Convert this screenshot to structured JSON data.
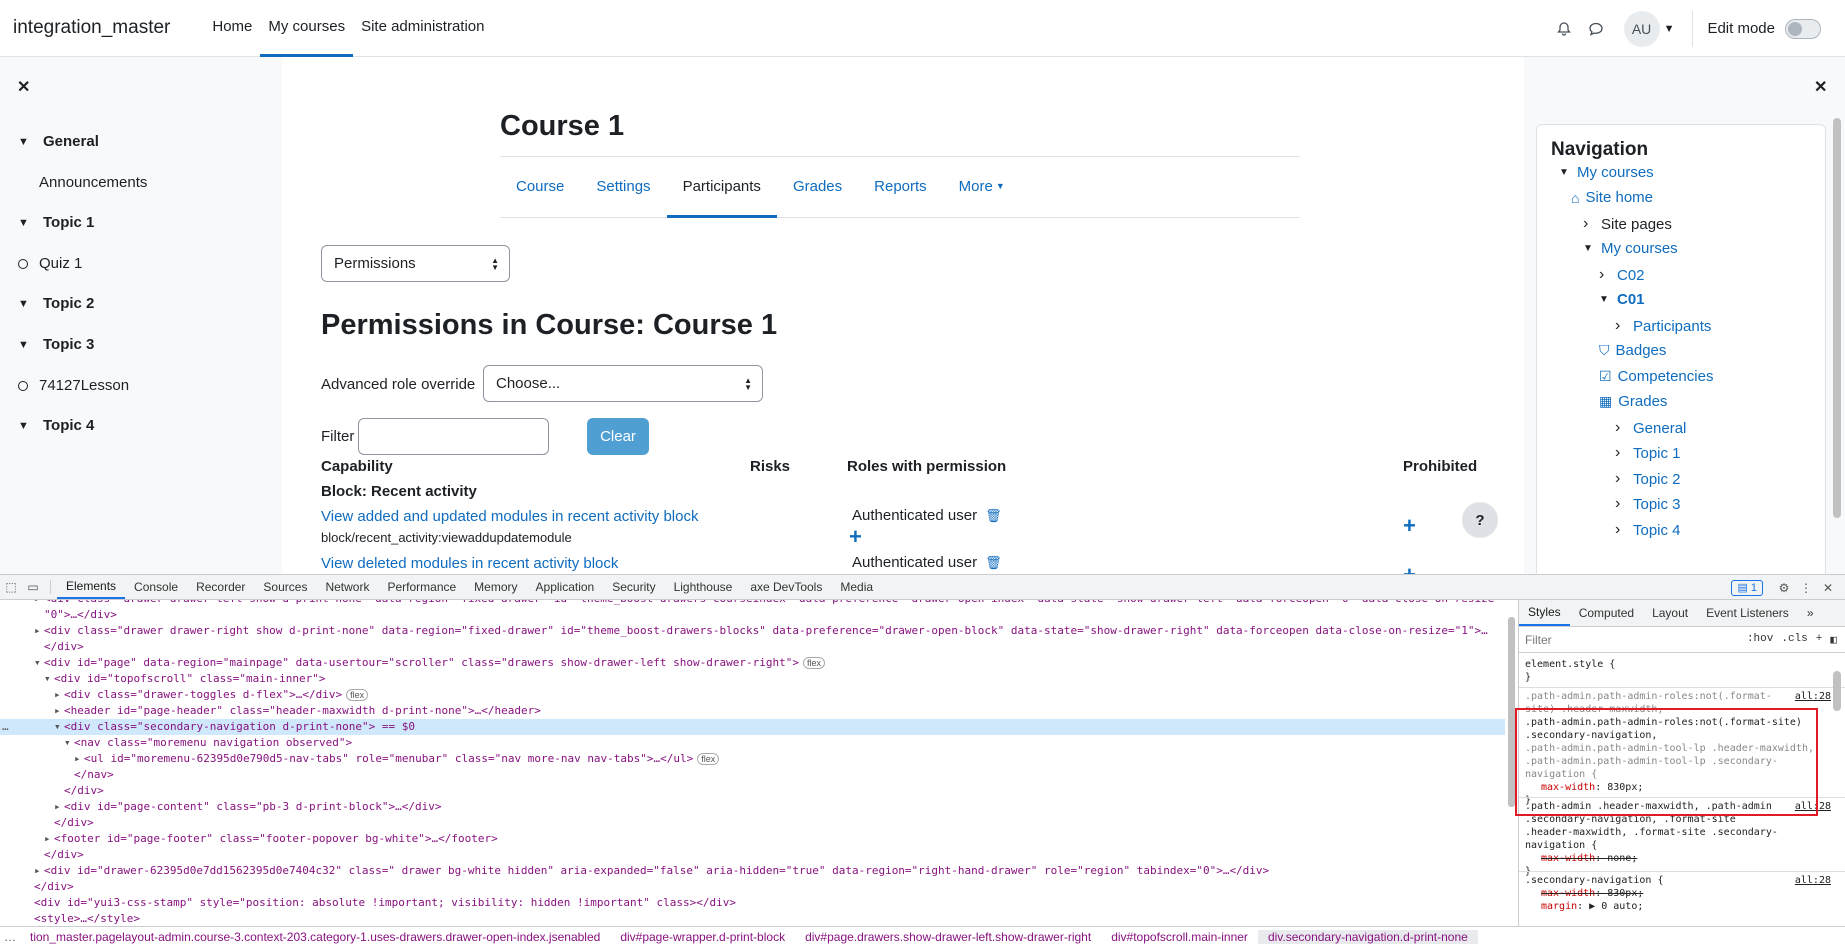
{
  "navbar": {
    "brand": "integration_master",
    "links": [
      "Home",
      "My courses",
      "Site administration"
    ],
    "active": "My courses",
    "avatar_initials": "AU",
    "edit_mode_label": "Edit mode"
  },
  "course_index": {
    "items": [
      {
        "type": "section",
        "label": "General"
      },
      {
        "type": "item",
        "label": "Announcements"
      },
      {
        "type": "section",
        "label": "Topic 1"
      },
      {
        "type": "activity",
        "label": "Quiz 1"
      },
      {
        "type": "section",
        "label": "Topic 2"
      },
      {
        "type": "section",
        "label": "Topic 3"
      },
      {
        "type": "activity",
        "label": "74127Lesson"
      },
      {
        "type": "section",
        "label": "Topic 4"
      }
    ]
  },
  "main": {
    "course_title": "Course 1",
    "tabs": [
      "Course",
      "Settings",
      "Participants",
      "Grades",
      "Reports",
      "More"
    ],
    "active_tab": "Participants",
    "page_select": "Permissions",
    "heading": "Permissions in Course: Course 1",
    "advanced_role_override_label": "Advanced role override",
    "advanced_role_override_value": "Choose...",
    "filter_label": "Filter",
    "filter_value": "",
    "clear_label": "Clear",
    "table": {
      "headers": [
        "Capability",
        "Risks",
        "Roles with permission",
        "Prohibited"
      ],
      "group": "Block: Recent activity",
      "rows": [
        {
          "capability": "View added and updated modules in recent activity block",
          "code": "block/recent_activity:viewaddupdatemodule",
          "role": "Authenticated user"
        },
        {
          "capability": "View deleted modules in recent activity block",
          "code": "",
          "role": "Authenticated user"
        }
      ]
    },
    "help_label": "?"
  },
  "navigation_block": {
    "title": "Navigation",
    "items": [
      {
        "label": "My courses",
        "style": "link",
        "chevron": "down",
        "icon": ""
      },
      {
        "label": "Site home",
        "style": "link",
        "chevron": "",
        "icon": "home-icon"
      },
      {
        "label": "Site pages",
        "style": "text",
        "chevron": "right",
        "icon": ""
      },
      {
        "label": "My courses",
        "style": "link",
        "chevron": "down",
        "icon": ""
      },
      {
        "label": "C02",
        "style": "link",
        "chevron": "right",
        "icon": ""
      },
      {
        "label": "C01",
        "style": "bold-link",
        "chevron": "down",
        "icon": ""
      },
      {
        "label": "Participants",
        "style": "link",
        "chevron": "right",
        "icon": ""
      },
      {
        "label": "Badges",
        "style": "link",
        "chevron": "",
        "icon": "shield-icon"
      },
      {
        "label": "Competencies",
        "style": "link",
        "chevron": "",
        "icon": "checkbox-icon"
      },
      {
        "label": "Grades",
        "style": "link",
        "chevron": "",
        "icon": "table-icon"
      },
      {
        "label": "General",
        "style": "link",
        "chevron": "right",
        "icon": ""
      },
      {
        "label": "Topic 1",
        "style": "link",
        "chevron": "right",
        "icon": ""
      },
      {
        "label": "Topic 2",
        "style": "link",
        "chevron": "right",
        "icon": ""
      },
      {
        "label": "Topic 3",
        "style": "link",
        "chevron": "right",
        "icon": ""
      },
      {
        "label": "Topic 4",
        "style": "link",
        "chevron": "right",
        "icon": ""
      }
    ]
  },
  "devtools": {
    "tabs": [
      "Elements",
      "Console",
      "Recorder",
      "Sources",
      "Network",
      "Performance",
      "Memory",
      "Application",
      "Security",
      "Lighthouse",
      "axe DevTools",
      "Media"
    ],
    "active_tab": "Elements",
    "issues_count": "1",
    "styles_tabs": [
      "Styles",
      "Computed",
      "Layout",
      "Event Listeners"
    ],
    "styles_active": "Styles",
    "filter_placeholder": "Filter",
    "hov": ":hov",
    "cls": ".cls",
    "dom_lines": [
      "<div class=\"drawer drawer-left show d-print-none\" data-region=\"fixed-drawer\" id=\"theme_boost-drawers-courseindex\" data-preference=\"drawer-open-index\" data-state=\"show-drawer-left\" data-forceopen=\"0\" data-close-on-resize=",
      "\"0\">…</div>",
      "<div class=\"drawer drawer-right show d-print-none\" data-region=\"fixed-drawer\" id=\"theme_boost-drawers-blocks\" data-preference=\"drawer-open-block\" data-state=\"show-drawer-right\" data-forceopen data-close-on-resize=\"1\">…",
      "</div>",
      "<div id=\"page\" data-region=\"mainpage\" data-usertour=\"scroller\" class=\"drawers show-drawer-left show-drawer-right\">",
      "<div id=\"topofscroll\" class=\"main-inner\">",
      "<div class=\"drawer-toggles d-flex\">…</div>",
      "<header id=\"page-header\" class=\"header-maxwidth d-print-none\">…</header>",
      "<div class=\"secondary-navigation d-print-none\"> == $0",
      "<nav class=\"moremenu navigation observed\">",
      "<ul id=\"moremenu-62395d0e790d5-nav-tabs\" role=\"menubar\" class=\"nav more-nav nav-tabs\">…</ul>",
      "</nav>",
      "</div>",
      "<div id=\"page-content\" class=\"pb-3 d-print-block\">…</div>",
      "</div>",
      "<footer id=\"page-footer\" class=\"footer-popover bg-white\">…</footer>",
      "</div>",
      "<div id=\"drawer-62395d0e7dd1562395d0e7404c32\" class=\" drawer bg-white hidden\" aria-expanded=\"false\" aria-hidden=\"true\" data-region=\"right-hand-drawer\" role=\"region\" tabindex=\"0\">…</div>",
      "</div>",
      "<div id=\"yui3-css-stamp\" style=\"position: absolute !important; visibility: hidden !important\" class></div>",
      "<style>…</style>"
    ],
    "flex_badge": "flex",
    "styles_rules": {
      "element_style": "element.style {",
      "rule1_selector_dim": ".path-admin.path-admin-roles:not(.format-site) .header-maxwidth,",
      "rule1_selector_hi": ".path-admin.path-admin-roles:not(.format-site) .secondary-navigation,",
      "rule1_selector_rest": ".path-admin.path-admin-tool-lp .header-maxwidth, .path-admin.path-admin-tool-lp .secondary-navigation {",
      "rule1_prop": "max-width",
      "rule1_value": "830px;",
      "rule2_selector": ".path-admin .header-maxwidth, .path-admin .secondary-navigation, .format-site .header-maxwidth, .format-site .secondary-navigation {",
      "rule2_prop": "max-width",
      "rule2_value": "none;",
      "rule3_selector": ".secondary-navigation {",
      "rule3_prop": "max-width",
      "rule3_value": "830px;",
      "rule3_prop2": "margin",
      "rule3_value2": "▶ 0 auto;",
      "source": "all:28"
    },
    "breadcrumbs": [
      "tion_master.pagelayout-admin.course-3.context-203.category-1.uses-drawers.drawer-open-index.jsenabled",
      "div#page-wrapper.d-print-block",
      "div#page.drawers.show-drawer-left.show-drawer-right",
      "div#topofscroll.main-inner",
      "div.secondary-navigation.d-print-none"
    ]
  }
}
